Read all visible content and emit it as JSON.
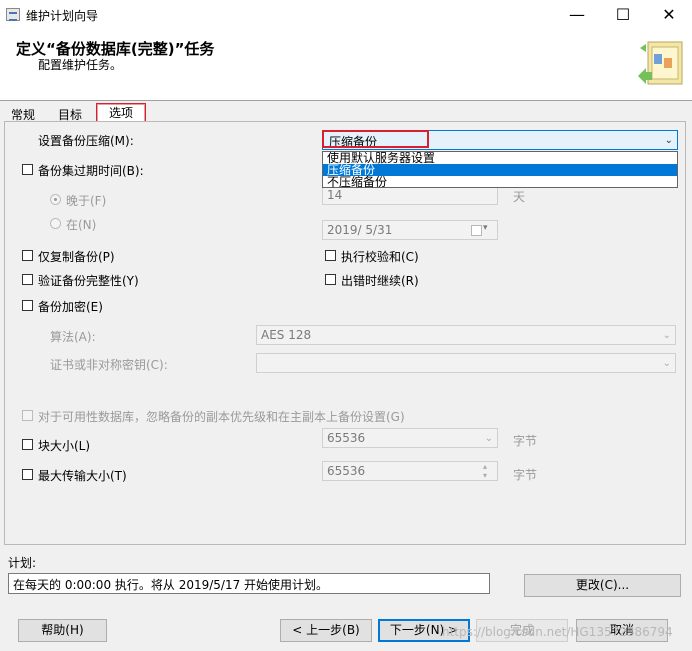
{
  "window": {
    "title": "维护计划向导",
    "controls": [
      "—",
      "☐",
      "✕"
    ]
  },
  "header": {
    "title": "定义“备份数据库(完整)”任务",
    "subtitle": "配置维护任务。"
  },
  "tabs": [
    {
      "label": "常规"
    },
    {
      "label": "目标"
    },
    {
      "label": "选项",
      "selected": true
    }
  ],
  "options": {
    "compression_label": "设置备份压缩(M):",
    "compression_value": "压缩备份",
    "compression_options": [
      "使用默认服务器设置",
      "压缩备份",
      "不压缩备份"
    ],
    "compression_selected_index": 1,
    "expire_label": "备份集过期时间(B):",
    "after_label": "晚于(F)",
    "after_value": "14",
    "days_unit": "天",
    "on_label": "在(N)",
    "date_value": "2019/ 5/31",
    "copy_only": "仅复制备份(P)",
    "checksum": "执行校验和(C)",
    "verify": "验证备份完整性(Y)",
    "continue_on_error": "出错时继续(R)",
    "encrypt": "备份加密(E)",
    "algorithm_label": "算法(A):",
    "algorithm_value": "AES 128",
    "cert_label": "证书或非对称密钥(C):",
    "cert_value": "",
    "availability_label": "对于可用性数据库，忽略备份的副本优先级和在主副本上备份设置(G)",
    "blocksize_label": "块大小(L)",
    "blocksize_value": "65536",
    "maxtransfer_label": "最大传输大小(T)",
    "maxtransfer_value": "65536",
    "byte_unit": "字节"
  },
  "schedule": {
    "label": "计划:",
    "value": "在每天的 0:00:00 执行。将从 2019/5/17 开始使用计划。",
    "change_button": "更改(C)..."
  },
  "footer": {
    "help": "帮助(H)",
    "back": "< 上一步(B)",
    "next": "下一步(N) >",
    "finish": "完成",
    "cancel": "取消"
  },
  "watermark": "https://blog.csdn.net/HG13572386794",
  "colors": {
    "accent": "#0078d7",
    "highlight_red": "#d9202f"
  }
}
